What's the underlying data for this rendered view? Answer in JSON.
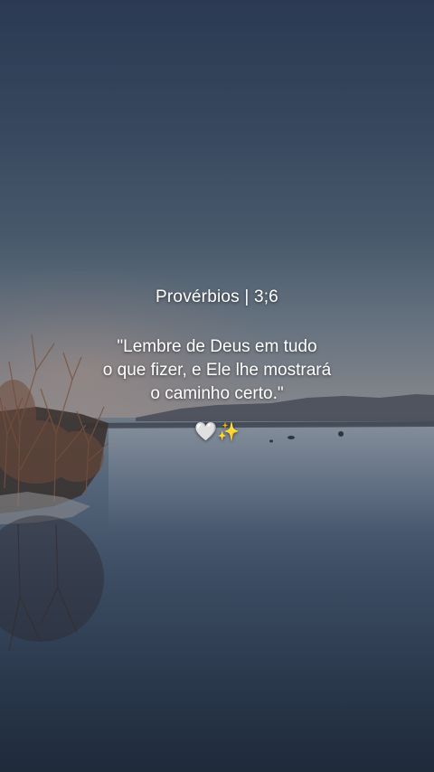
{
  "post": {
    "reference": "Provérbios | 3;6",
    "quote_lines": [
      "\"Lembre de Deus em tudo",
      "o que fizer, e Ele lhe mostrará",
      "o caminho certo.\""
    ],
    "emoji": {
      "heart": "🤍",
      "sparkles": "✨"
    }
  },
  "colors": {
    "text": "#ffffff",
    "sky_top": "#2b3a52",
    "horizon": "#8b8a8e",
    "water_deep": "#1f2a3a"
  }
}
